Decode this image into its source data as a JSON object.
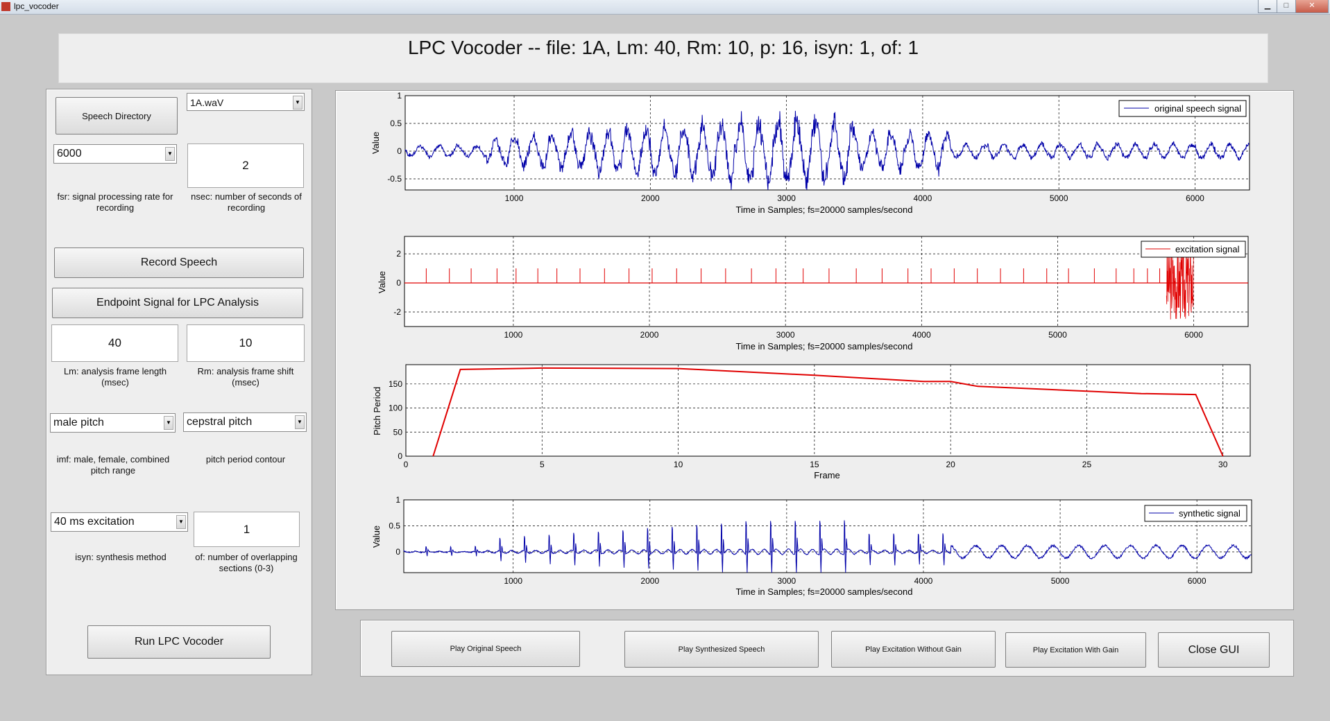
{
  "window": {
    "title": "lpc_vocoder"
  },
  "header": {
    "title": "LPC Vocoder -- file: 1A, Lm: 40, Rm: 10, p: 16, isyn: 1, of: 1"
  },
  "left": {
    "speech_dir_label": "Speech Directory",
    "file_select": "1A.waV",
    "fsr_select": "6000",
    "nsec_value": "2",
    "fsr_caption": "fsr: signal processing rate for recording",
    "nsec_caption": "nsec: number of seconds of recording",
    "record_label": "Record Speech",
    "endpoint_label": "Endpoint Signal for LPC Analysis",
    "lm_value": "40",
    "rm_value": "10",
    "lm_caption": "Lm: analysis frame length (msec)",
    "rm_caption": "Rm: analysis frame shift (msec)",
    "imf_select": "male pitch",
    "pitch_select": "cepstral pitch",
    "imf_caption": "imf: male, female, combined pitch range",
    "pitch_caption": "pitch period contour",
    "isyn_select": "40 ms excitation",
    "of_value": "1",
    "isyn_caption": "isyn: synthesis method",
    "of_caption": "of: number of overlapping sections (0-3)",
    "run_label": "Run LPC Vocoder"
  },
  "bottom": {
    "play_original": "Play Original Speech",
    "play_synth": "Play Synthesized Speech",
    "play_exc_nogain": "Play Excitation Without Gain",
    "play_exc_gain": "Play Excitation With Gain",
    "close": "Close GUI"
  },
  "colors": {
    "blue": "#0000a8",
    "red": "#e00000"
  },
  "chart_data": [
    {
      "type": "line",
      "series": [
        {
          "name": "original speech signal"
        }
      ],
      "xlabel": "Time in Samples; fs=20000 samples/second",
      "ylabel": "Value",
      "xlim": [
        200,
        6400
      ],
      "ylim": [
        -0.7,
        1
      ],
      "xticks": [
        "1000",
        "2000",
        "3000",
        "4000",
        "5000",
        "6000"
      ],
      "yticks": [
        "-0.5",
        "0",
        "0.5",
        "1"
      ],
      "grid": true,
      "legend": "top-right"
    },
    {
      "type": "line",
      "series": [
        {
          "name": "excitation signal"
        }
      ],
      "xlabel": "Time in Samples; fs=20000 samples/second",
      "ylabel": "Value",
      "xlim": [
        200,
        6400
      ],
      "ylim": [
        -3,
        3.2
      ],
      "xticks": [
        "1000",
        "2000",
        "3000",
        "4000",
        "5000",
        "6000"
      ],
      "yticks": [
        "-2",
        "0",
        "2"
      ],
      "grid": true,
      "legend": "top-right",
      "pulse_x": [
        360,
        530,
        690,
        880,
        1020,
        1180,
        1320,
        1490,
        1670,
        1850,
        2020,
        2200,
        2380,
        2560,
        2750,
        2930,
        3130,
        3320,
        3520,
        3710,
        3900,
        4070,
        4240,
        4410,
        4580,
        4750,
        4920,
        5080,
        5270,
        5430,
        5560,
        5660,
        5750
      ]
    },
    {
      "type": "line",
      "series": [
        {
          "name": "Pitch Period",
          "x": [
            1,
            2,
            5,
            10,
            15,
            19,
            20,
            21,
            25,
            27,
            29,
            30
          ],
          "values": [
            0,
            180,
            183,
            182,
            168,
            155,
            155,
            145,
            135,
            130,
            128,
            0
          ]
        }
      ],
      "xlabel": "Frame",
      "ylabel": "Pitch Period",
      "xlim": [
        0,
        31
      ],
      "ylim": [
        0,
        190
      ],
      "xticks": [
        "0",
        "5",
        "10",
        "15",
        "20",
        "25",
        "30"
      ],
      "yticks": [
        "0",
        "50",
        "100",
        "150"
      ],
      "grid": true
    },
    {
      "type": "line",
      "series": [
        {
          "name": "synthetic signal"
        }
      ],
      "xlabel": "Time in Samples; fs=20000 samples/second",
      "ylabel": "Value",
      "xlim": [
        200,
        6400
      ],
      "ylim": [
        -0.4,
        1
      ],
      "xticks": [
        "1000",
        "2000",
        "3000",
        "4000",
        "5000",
        "6000"
      ],
      "yticks": [
        "0",
        "0.5",
        "1"
      ],
      "grid": true,
      "legend": "top-right"
    }
  ]
}
